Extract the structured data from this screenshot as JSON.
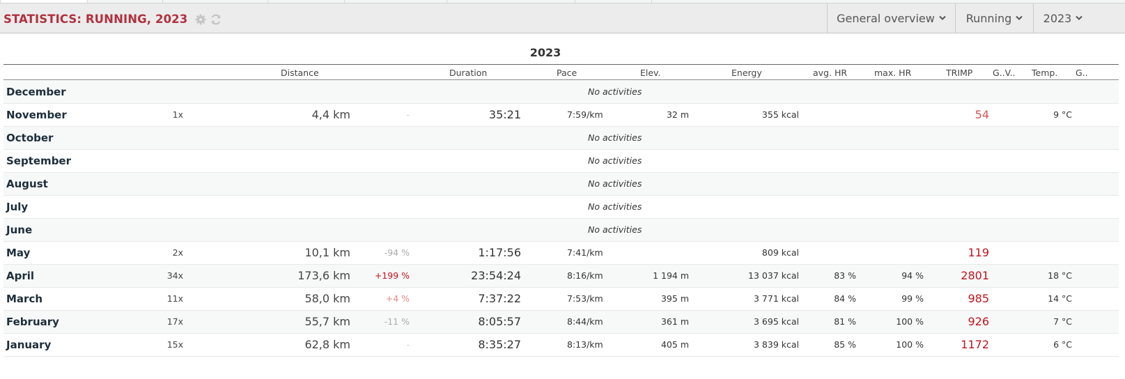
{
  "header": {
    "title": "STATISTICS: RUNNING, 2023",
    "icons": [
      "gear-icon",
      "refresh-icon"
    ],
    "view_select": "General overview",
    "sport_select": "Running",
    "year_select": "2023"
  },
  "table": {
    "year": "2023",
    "columns": {
      "distance": "Distance",
      "duration": "Duration",
      "pace": "Pace",
      "elev": "Elev.",
      "energy": "Energy",
      "avg_hr": "avg. HR",
      "max_hr": "max. HR",
      "trimp": "TRIMP",
      "gv": "G..V..",
      "temp": "Temp.",
      "g": "G.."
    },
    "no_activities_text": "No activities",
    "rows": [
      {
        "month": "December",
        "no_activities": true
      },
      {
        "month": "November",
        "count": "1x",
        "distance": "4,4 km",
        "change": "-",
        "duration": "35:21",
        "pace": "7:59/km",
        "elev": "32 m",
        "energy": "355 kcal",
        "avg_hr": "",
        "max_hr": "",
        "trimp": "54",
        "temp": "9 °C"
      },
      {
        "month": "October",
        "no_activities": true
      },
      {
        "month": "September",
        "no_activities": true
      },
      {
        "month": "August",
        "no_activities": true
      },
      {
        "month": "July",
        "no_activities": true
      },
      {
        "month": "June",
        "no_activities": true
      },
      {
        "month": "May",
        "count": "2x",
        "distance": "10,1 km",
        "change": "-94 %",
        "duration": "1:17:56",
        "pace": "7:41/km",
        "elev": "",
        "energy": "809 kcal",
        "avg_hr": "",
        "max_hr": "",
        "trimp": "119",
        "temp": ""
      },
      {
        "month": "April",
        "count": "34x",
        "distance": "173,6 km",
        "change": "+199 %",
        "duration": "23:54:24",
        "pace": "8:16/km",
        "elev": "1 194 m",
        "energy": "13 037 kcal",
        "avg_hr": "83 %",
        "max_hr": "94 %",
        "trimp": "2801",
        "temp": "18 °C"
      },
      {
        "month": "March",
        "count": "11x",
        "distance": "58,0 km",
        "change": "+4 %",
        "duration": "7:37:22",
        "pace": "7:53/km",
        "elev": "395 m",
        "energy": "3 771 kcal",
        "avg_hr": "84 %",
        "max_hr": "99 %",
        "trimp": "985",
        "temp": "14 °C"
      },
      {
        "month": "February",
        "count": "17x",
        "distance": "55,7 km",
        "change": "-11 %",
        "duration": "8:05:57",
        "pace": "8:44/km",
        "elev": "361 m",
        "energy": "3 695 kcal",
        "avg_hr": "81 %",
        "max_hr": "100 %",
        "trimp": "926",
        "temp": "7 °C"
      },
      {
        "month": "January",
        "count": "15x",
        "distance": "62,8 km",
        "change": "-",
        "duration": "8:35:27",
        "pace": "8:13/km",
        "elev": "405 m",
        "energy": "3 839 kcal",
        "avg_hr": "85 %",
        "max_hr": "100 %",
        "trimp": "1172",
        "temp": "6 °C"
      }
    ]
  },
  "colors": {
    "title": "#b0313f",
    "trimp_low": "#d9534f",
    "trimp_high": "#c0141e",
    "change_positive_strong": "#c0141e",
    "change_positive_weak": "#e08a84",
    "change_negative": "#aaaaaa",
    "change_neutral": "#cccccc"
  }
}
